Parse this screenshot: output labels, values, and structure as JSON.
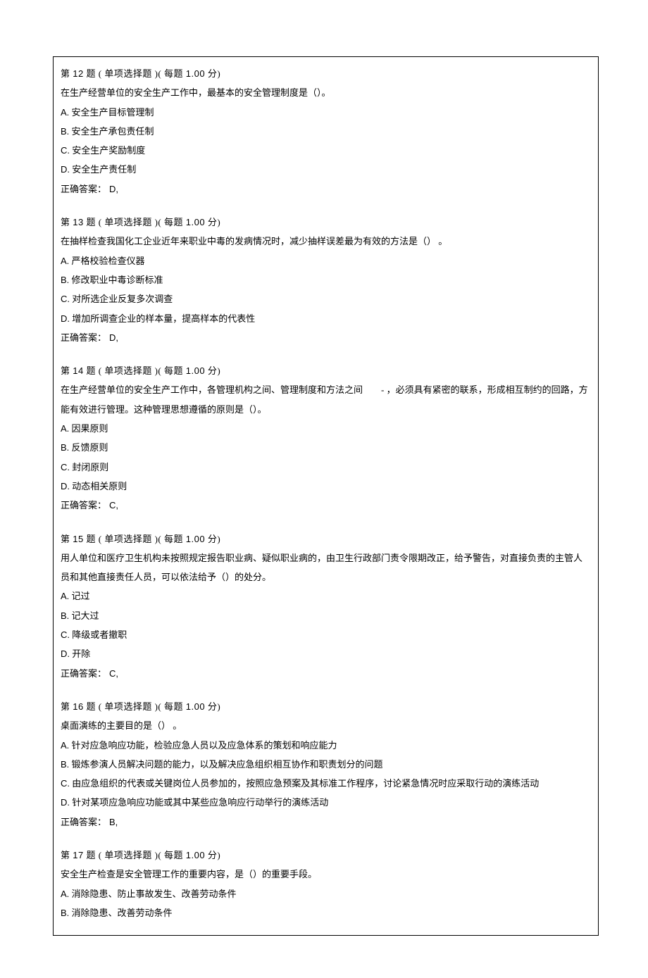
{
  "labels": {
    "di": "第",
    "ti": "题",
    "meiti": "每题",
    "fen": "分",
    "type_single": "( 单项选择题 )(",
    "type_single_spaced": "(  单项选择题  )(",
    "answer_prefix": "正确答案："
  },
  "questions": [
    {
      "num": "12",
      "type_key": "type_single",
      "header_gap": "  ",
      "points": "1.00",
      "fen_gap": "  ",
      "stem": "在生产经营单位的安全生产工作中，最基本的安全管理制度是（）。",
      "options": [
        {
          "letter": "A.",
          "text": " 安全生产目标管理制"
        },
        {
          "letter": "B.",
          "text": " 安全生产承包责任制"
        },
        {
          "letter": "C.",
          "text": " 安全生产奖励制度"
        },
        {
          "letter": "D.",
          "text": " 安全生产责任制"
        }
      ],
      "answer": "D,",
      "tight_answer": true
    },
    {
      "num": "13",
      "type_key": "type_single",
      "header_gap": "  ",
      "points": "1.00",
      "fen_gap": "  ",
      "stem": "在抽样检查我国化工企业近年来职业中毒的发病情况时，减少抽样误差最为有效的方法是（） 。",
      "options": [
        {
          "letter": "A.",
          "text": " 严格校验检查仪器"
        },
        {
          "letter": "B.",
          "text": " 修改职业中毒诊断标准"
        },
        {
          "letter": "C.",
          "text": " 对所选企业反复多次调查"
        },
        {
          "letter": "D.",
          "text": " 增加所调查企业的样本量，提高样本的代表性"
        }
      ],
      "answer": "D,",
      "tight_answer": true
    },
    {
      "num": "14",
      "type_key": "type_single_spaced",
      "header_gap": "   ",
      "points": "1.00",
      "fen_gap": "   ",
      "stem": "在生产经营单位的安全生产工作中，各管理机构之间、管理制度和方法之间  - ，必须具有紧密的联系，形成相互制约的回路，方能有效进行管理。这种管理思想遵循的原则是（）。",
      "options": [
        {
          "letter": "A.",
          "text": " 因果原则"
        },
        {
          "letter": "B.",
          "text": " 反馈原则"
        },
        {
          "letter": "C.",
          "text": " 封闭原则"
        },
        {
          "letter": "D.",
          "text": " 动态相关原则"
        }
      ],
      "answer": "C,",
      "tight_answer": false
    },
    {
      "num": "15",
      "type_key": "type_single",
      "header_gap": "  ",
      "points": "1.00",
      "fen_gap": "  ",
      "stem": "用人单位和医疗卫生机构未按照规定报告职业病、疑似职业病的，由卫生行政部门责令限期改正，给予警告，对直接负责的主管人员和其他直接责任人员，可以依法给予（）的处分。",
      "options": [
        {
          "letter": "A.",
          "text": " 记过"
        },
        {
          "letter": "B.",
          "text": " 记大过"
        },
        {
          "letter": "C.",
          "text": " 降级或者撤职"
        },
        {
          "letter": "D.",
          "text": " 开除"
        }
      ],
      "answer": "C,",
      "tight_answer": false
    },
    {
      "num": "16",
      "type_key": "type_single",
      "header_gap": "  ",
      "points": "1.00",
      "fen_gap": "  ",
      "stem": "桌面演练的主要目的是（） 。",
      "options": [
        {
          "letter": "A.",
          "text": " 针对应急响应功能，检验应急人员以及应急体系的策划和响应能力"
        },
        {
          "letter": "B.",
          "text": " 锻炼参演人员解决问题的能力，以及解决应急组织相互协作和职责划分的问题"
        },
        {
          "letter": "C.",
          "text": " 由应急组织的代表或关键岗位人员参加的，按照应急预案及其标准工作程序，讨论紧急情况时应采取行动的演练活动"
        },
        {
          "letter": "D.",
          "text": " 针对某项应急响应功能或其中某些应急响应行动举行的演练活动"
        }
      ],
      "answer": "B,",
      "tight_answer": false
    },
    {
      "num": "17",
      "type_key": "type_single",
      "header_gap": "  ",
      "points": "1.00",
      "fen_gap": "  ",
      "stem": "安全生产检查是安全管理工作的重要内容，是（）的重要手段。",
      "options": [
        {
          "letter": "A.",
          "text": " 消除隐患、防止事故发生、改善劳动条件"
        },
        {
          "letter": "B.",
          "text": " 消除隐患、改善劳动条件"
        }
      ],
      "answer": null,
      "tight_answer": false
    }
  ]
}
